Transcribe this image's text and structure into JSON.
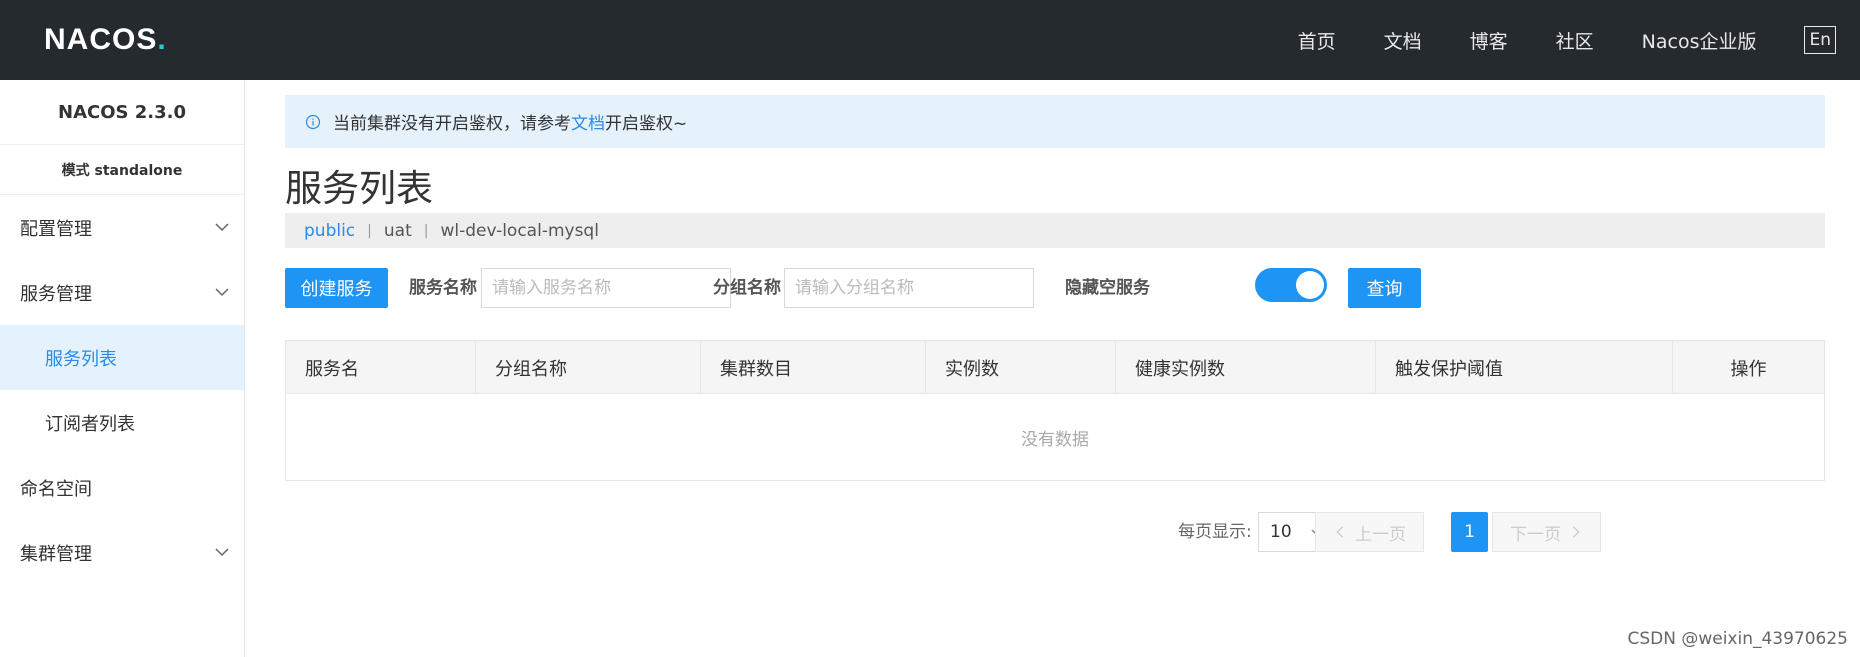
{
  "header": {
    "logo_main": "NACOS",
    "logo_dot": ".",
    "nav": [
      "首页",
      "文档",
      "博客",
      "社区",
      "Nacos企业版"
    ],
    "lang": "En"
  },
  "sidebar": {
    "version": "NACOS 2.3.0",
    "mode": "模式 standalone",
    "items": [
      {
        "label": "配置管理"
      },
      {
        "label": "服务管理"
      },
      {
        "label": "服务列表"
      },
      {
        "label": "订阅者列表"
      },
      {
        "label": "命名空间"
      },
      {
        "label": "集群管理"
      }
    ]
  },
  "alert": {
    "prefix": "当前集群没有开启鉴权，请参考",
    "link": "文档",
    "suffix": "开启鉴权~"
  },
  "page": {
    "title": "服务列表"
  },
  "namespaces": [
    "public",
    "uat",
    "wl-dev-local-mysql"
  ],
  "filter": {
    "create_label": "创建服务",
    "service_name_label": "服务名称",
    "service_name_placeholder": "请输入服务名称",
    "group_name_label": "分组名称",
    "group_name_placeholder": "请输入分组名称",
    "hide_empty_label": "隐藏空服务",
    "hide_empty_on": true,
    "query_label": "查询"
  },
  "table": {
    "columns": [
      "服务名",
      "分组名称",
      "集群数目",
      "实例数",
      "健康实例数",
      "触发保护阈值",
      "操作"
    ],
    "empty_text": "没有数据"
  },
  "pagination": {
    "per_page_label": "每页显示:",
    "page_size": "10",
    "prev_label": "上一页",
    "next_label": "下一页",
    "current_page": "1"
  },
  "watermark": "CSDN @weixin_43970625",
  "colors": {
    "header_bg": "#252a2f",
    "primary": "#1e95f5",
    "link": "#2a8ae8",
    "alert_bg": "#e5f2fc",
    "active_bg": "#e4f2fd"
  }
}
